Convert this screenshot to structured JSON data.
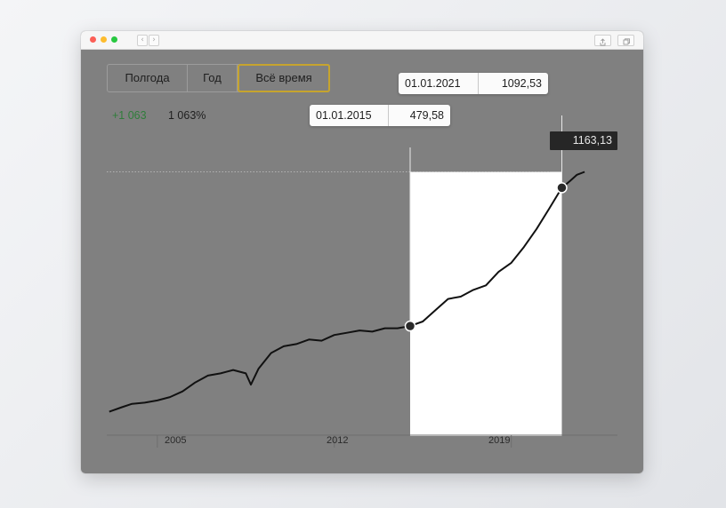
{
  "window": {
    "nav_back": "‹",
    "nav_forward": "›"
  },
  "range_selector": {
    "options": [
      "Полгода",
      "Год",
      "Всё время"
    ],
    "selected": "Всё время"
  },
  "summary": {
    "change": "+1 063",
    "change_pct": "1 063%",
    "change_color": "#2f7d3a"
  },
  "selection": {
    "start": {
      "date": "01.01.2015",
      "value": "479,58"
    },
    "end": {
      "date": "01.01.2021",
      "value": "1092,53"
    }
  },
  "last_value": "1163,13",
  "colors": {
    "highlight": "#c6a42e",
    "line": "#111111",
    "overlay": "#808080",
    "selection_fill": "#ffffff"
  },
  "chart_data": {
    "type": "line",
    "x_tick_labels": [
      "2005",
      "2012",
      "2019"
    ],
    "x_ticks": [
      2005,
      2012,
      2019
    ],
    "xlim": [
      2003,
      2023.2
    ],
    "ylim": [
      0,
      1350
    ],
    "x": [
      2003.1,
      2003.6,
      2004.0,
      2004.5,
      2005.0,
      2005.5,
      2006.0,
      2006.5,
      2007.0,
      2007.5,
      2008.0,
      2008.5,
      2008.7,
      2009.0,
      2009.5,
      2010.0,
      2010.5,
      2011.0,
      2011.5,
      2012.0,
      2012.5,
      2013.0,
      2013.5,
      2014.0,
      2014.5,
      2015.0,
      2015.5,
      2016.0,
      2016.5,
      2017.0,
      2017.5,
      2018.0,
      2018.5,
      2019.0,
      2019.5,
      2020.0,
      2020.5,
      2021.0,
      2021.3,
      2021.6,
      2021.9
    ],
    "series": [
      {
        "values": [
          100,
          120,
          135,
          140,
          150,
          165,
          190,
          230,
          260,
          270,
          285,
          270,
          220,
          290,
          360,
          390,
          400,
          420,
          415,
          440,
          450,
          460,
          455,
          470,
          470,
          479.6,
          500,
          550,
          600,
          610,
          640,
          660,
          720,
          760,
          830,
          910,
          1000,
          1092.5,
          1120,
          1150,
          1163.1
        ]
      }
    ],
    "highlight_range": {
      "from": 2015.0,
      "to": 2021.0
    },
    "markers": [
      {
        "x": 2015.0,
        "y": 479.58
      },
      {
        "x": 2021.0,
        "y": 1092.53
      }
    ],
    "reference_line_value": 1163.13
  }
}
